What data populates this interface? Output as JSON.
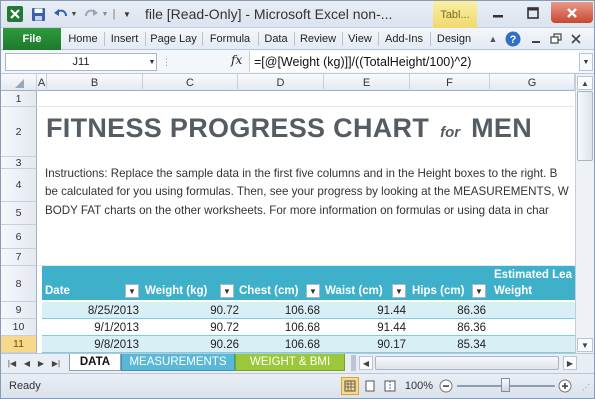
{
  "window": {
    "title": "file  [Read-Only]  -  Microsoft Excel non-...",
    "context_tab": "Tabl...",
    "quick_access": [
      "excel-logo-icon",
      "save-icon",
      "undo-icon",
      "redo-icon",
      "customize-icon"
    ],
    "controls": [
      "minimize-icon",
      "maximize-icon",
      "close-icon"
    ]
  },
  "ribbon": {
    "file_tab": "File",
    "tabs": [
      "Home",
      "Insert",
      "Page Lay",
      "Formula",
      "Data",
      "Review",
      "View",
      "Add-Ins",
      "Design"
    ]
  },
  "formula_bar": {
    "name_box": "J11",
    "fx_label": "fx",
    "formula": "=[@[Weight (kg)]]/((TotalHeight/100)^2)"
  },
  "columns": [
    "A",
    "B",
    "C",
    "D",
    "E",
    "F",
    "G"
  ],
  "rows": [
    "1",
    "2",
    "3",
    "4",
    "5",
    "6",
    "7",
    "8",
    "9",
    "10",
    "11"
  ],
  "selected_row": "11",
  "sheet": {
    "title_main": "FITNESS PROGRESS CHART",
    "title_for": "for",
    "title_men": "MEN",
    "instructions": [
      "Instructions: Replace the sample data in the first five columns and in the Height boxes to the right. B",
      "be calculated for you using formulas. Then, see your progress by looking at the MEASUREMENTS, W",
      "BODY FAT charts on the other worksheets. For more information on formulas or using data in char"
    ],
    "table": {
      "headers": [
        "Date",
        "Weight (kg)",
        "Chest (cm)",
        "Waist (cm)",
        "Hips (cm)"
      ],
      "extra_header_line1": "Estimated Lea",
      "extra_header_line2": "Weight",
      "rows": [
        [
          "8/25/2013",
          "90.72",
          "106.68",
          "91.44",
          "86.36"
        ],
        [
          "9/1/2013",
          "90.72",
          "106.68",
          "91.44",
          "86.36"
        ],
        [
          "9/8/2013",
          "90.26",
          "106.68",
          "90.17",
          "85.34"
        ]
      ]
    }
  },
  "sheet_tabs": {
    "tabs": [
      "DATA",
      "MEASUREMENTS",
      "WEIGHT & BMI"
    ],
    "active": "DATA"
  },
  "status_bar": {
    "status": "Ready",
    "zoom": "100%"
  },
  "colors": {
    "table_header": "#3fb0ca",
    "band_light": "#d9eff6",
    "title_gray": "#555c63",
    "file_green": "#1d7a2c"
  }
}
